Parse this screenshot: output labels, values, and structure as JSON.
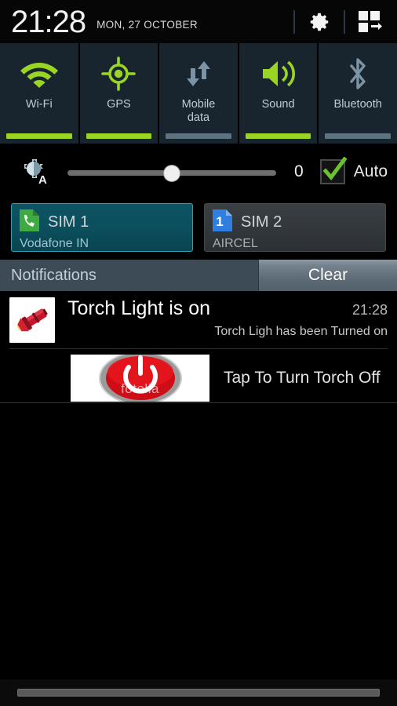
{
  "statusbar": {
    "time": "21:28",
    "date": "MON, 27 OCTOBER",
    "settings_icon": "gear-icon",
    "multiwindow_icon": "multi-window-icon"
  },
  "quick_toggles": [
    {
      "label": "Wi-Fi",
      "icon": "wifi-icon",
      "state": "on"
    },
    {
      "label": "GPS",
      "icon": "gps-icon",
      "state": "on"
    },
    {
      "label": "Mobile\ndata",
      "label_line1": "Mobile",
      "label_line2": "data",
      "icon": "mobile-data-icon",
      "state": "off"
    },
    {
      "label": "Sound",
      "icon": "sound-icon",
      "state": "on"
    },
    {
      "label": "Bluetooth",
      "icon": "bluetooth-icon",
      "state": "off"
    }
  ],
  "brightness": {
    "icon": "auto-brightness-icon",
    "value": "0",
    "slider_percent": 50,
    "auto_label": "Auto",
    "auto_checked": true
  },
  "sims": [
    {
      "name": "SIM 1",
      "carrier": "Vodafone IN",
      "icon": "sim-phone-icon",
      "selected": true
    },
    {
      "name": "SIM 2",
      "carrier": "AIRCEL",
      "icon": "sim-1-icon",
      "selected": false
    }
  ],
  "notifications_header": {
    "title": "Notifications",
    "clear_label": "Clear"
  },
  "notification": {
    "app_icon": "torch-icon",
    "title": "Torch Light is on",
    "time": "21:28",
    "text": "Torch Ligh has been Turned on",
    "action_image_icon": "power-button-icon",
    "action_image_watermark": "fotolia",
    "action_label": "Tap To Turn Torch Off"
  },
  "colors": {
    "accent_green": "#9ad425",
    "tile_bg": "#18252e",
    "inactive_gray": "#5d7382",
    "sim_active_bg": "#0b4e5c",
    "header_bg": "#3d4b57"
  },
  "bottom_handle": "drag-handle"
}
